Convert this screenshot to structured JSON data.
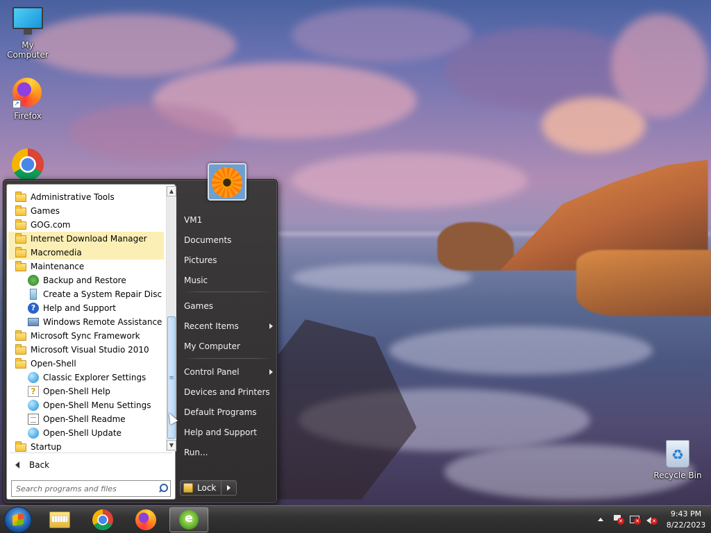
{
  "desktop": {
    "icons": [
      {
        "label": "My Computer"
      },
      {
        "label": "Firefox"
      },
      {
        "label": "Recycle Bin"
      }
    ]
  },
  "start_menu": {
    "programs": [
      {
        "label": "Administrative Tools",
        "icon": "folder-icon"
      },
      {
        "label": "Games",
        "icon": "folder-icon"
      },
      {
        "label": "GOG.com",
        "icon": "folder-icon"
      },
      {
        "label": "Internet Download Manager",
        "icon": "folder-icon",
        "highlighted": true
      },
      {
        "label": "Macromedia",
        "icon": "folder-icon",
        "highlighted": true
      },
      {
        "label": "Maintenance",
        "icon": "folder-icon"
      },
      {
        "label": "Backup and Restore",
        "icon": "backup-icon"
      },
      {
        "label": "Create a System Repair Disc",
        "icon": "disc-icon"
      },
      {
        "label": "Help and Support",
        "icon": "help-icon"
      },
      {
        "label": "Windows Remote Assistance",
        "icon": "remote-icon"
      },
      {
        "label": "Microsoft Sync Framework",
        "icon": "folder-icon"
      },
      {
        "label": "Microsoft Visual Studio 2010",
        "icon": "folder-icon"
      },
      {
        "label": "Open-Shell",
        "icon": "folder-icon"
      },
      {
        "label": "Classic Explorer Settings",
        "icon": "app-icon"
      },
      {
        "label": "Open-Shell Help",
        "icon": "qhelp-icon"
      },
      {
        "label": "Open-Shell Menu Settings",
        "icon": "app-icon"
      },
      {
        "label": "Open-Shell Readme",
        "icon": "doc-icon"
      },
      {
        "label": "Open-Shell Update",
        "icon": "app-icon"
      },
      {
        "label": "Startup",
        "icon": "folder-icon"
      }
    ],
    "back_label": "Back",
    "search_placeholder": "Search programs and files",
    "right_items": [
      {
        "label": "VM1"
      },
      {
        "label": "Documents"
      },
      {
        "label": "Pictures"
      },
      {
        "label": "Music"
      },
      {
        "label": "Games"
      },
      {
        "label": "Recent Items",
        "submenu": true
      },
      {
        "label": "My Computer"
      },
      {
        "label": "Control Panel",
        "submenu": true
      },
      {
        "label": "Devices and Printers"
      },
      {
        "label": "Default Programs"
      },
      {
        "label": "Help and Support"
      },
      {
        "label": "Run..."
      }
    ],
    "lock_label": "Lock"
  },
  "taskbar": {
    "pinned": [
      "explorer",
      "chrome",
      "firefox",
      "internet-download-manager"
    ],
    "active_app": "internet-download-manager",
    "clock": {
      "time": "9:43 PM",
      "date": "8/22/2023"
    }
  },
  "colors": {
    "highlight": "#fbefb5",
    "menu_dark": "#2f2d2d"
  }
}
